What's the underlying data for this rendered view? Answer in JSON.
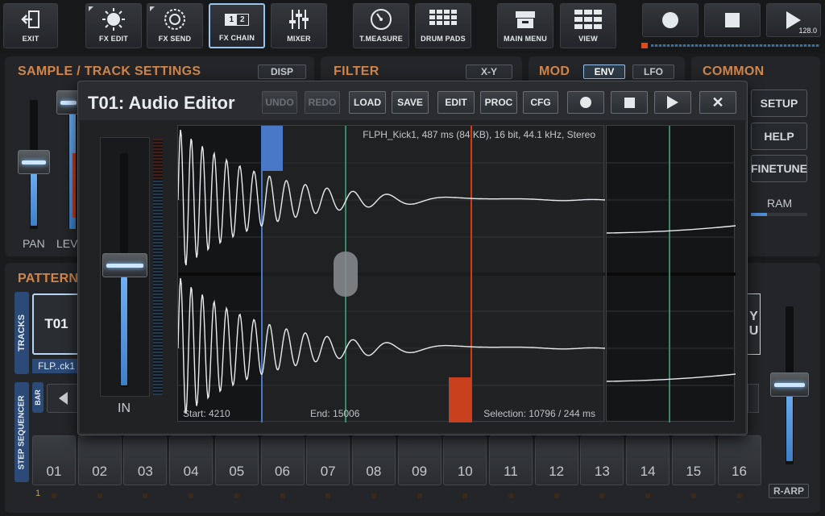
{
  "toolbar": {
    "exit": "EXIT",
    "fx_edit": "FX EDIT",
    "fx_send": "FX SEND",
    "fx_chain": "FX CHAIN",
    "fx_chain_a": "1",
    "fx_chain_b": "2",
    "mixer": "MIXER",
    "t_measure": "T.MEASURE",
    "drum_pads": "DRUM PADS",
    "main_menu": "MAIN MENU",
    "view": "VIEW",
    "tempo": "128.0"
  },
  "sections": {
    "sample_track": "SAMPLE / TRACK SETTINGS",
    "disp": "DISP",
    "filter": "FILTER",
    "xy": "X-Y",
    "mod": "MOD",
    "env": "ENV",
    "lfo": "LFO",
    "common": "COMMON",
    "pan": "PAN",
    "lev": "LEV",
    "setup": "SETUP",
    "help": "HELP",
    "finetune": "FINETUNE",
    "ram": "RAM",
    "pattern": "PATTERN",
    "tracks_tab": "TRACKS",
    "track_id": "T01",
    "track_sample": "FLP..ck1",
    "step_sequencer_tab": "STEP SEQUENCER",
    "bar_tab": "BAR",
    "r_arp": "R-ARP",
    "edge_y": "Y",
    "edge_u": "U"
  },
  "editor": {
    "title": "T01: Audio Editor",
    "buttons": {
      "undo": "UNDO",
      "redo": "REDO",
      "load": "LOAD",
      "save": "SAVE",
      "edit": "EDIT",
      "proc": "PROC",
      "cfg": "CFG"
    },
    "in_label": "IN",
    "file_info": "FLPH_Kick1, 487 ms (84 KB), 16 bit, 44.1 kHz, Stereo",
    "start": "Start: 4210",
    "end": "End: 15006",
    "selection": "Selection: 10796 / 244 ms",
    "input_level": 0.52
  },
  "steps": {
    "numbers": [
      "01",
      "02",
      "03",
      "04",
      "05",
      "06",
      "07",
      "08",
      "09",
      "10",
      "11",
      "12",
      "13",
      "14",
      "15",
      "16"
    ],
    "first_indicator": "1"
  },
  "colors": {
    "accent_orange": "#d2864b",
    "selection_blue": "#4a78c8",
    "playhead_green": "#3fae7e",
    "end_marker_red": "#c8401e"
  }
}
